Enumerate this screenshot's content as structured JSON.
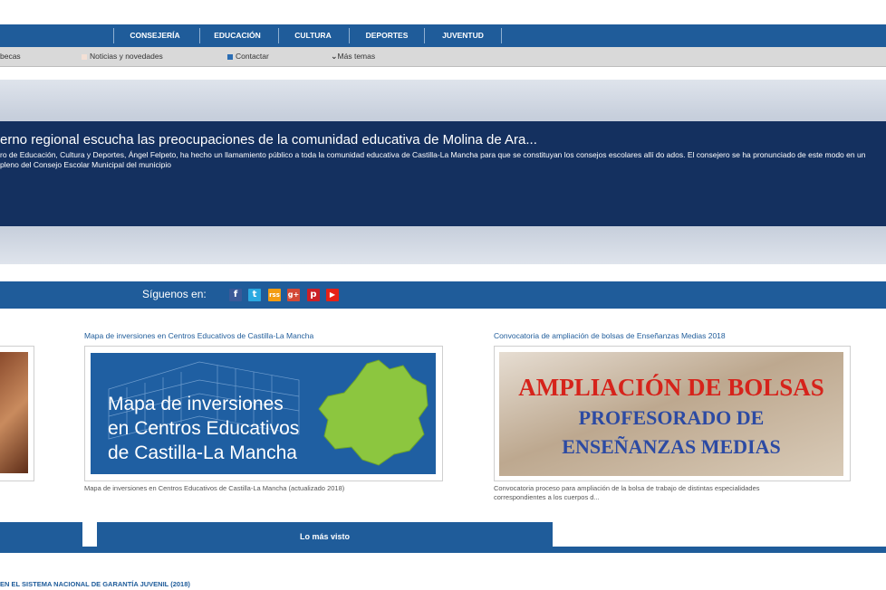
{
  "top_nav": {
    "items": [
      "CONSEJERÍA",
      "EDUCACIÓN",
      "CULTURA",
      "DEPORTES",
      "JUVENTUD"
    ]
  },
  "sub_nav": {
    "becas": "becas",
    "noticias": "Noticias y novedades",
    "contactar": "Contactar",
    "mas_temas": "Más temas"
  },
  "hero": {
    "title": "erno regional escucha las preocupaciones de la comunidad educativa de Molina de Ara...",
    "text": "ro de Educación, Cultura y Deportes, Ángel Felpeto, ha hecho un llamamiento público a toda la comunidad educativa de Castilla-La Mancha para que se constituyan los consejos escolares allí do ados. El consejero se ha pronunciado de este modo en un pleno del Consejo Escolar Municipal del municipio"
  },
  "follow": {
    "label": "Síguenos en:",
    "icons": [
      "f",
      "t",
      "rss",
      "g+",
      "p",
      "▶"
    ]
  },
  "cards": [
    {
      "title": "Mapa de inversiones en Centros Educativos de Castilla-La Mancha",
      "image_text": [
        "Mapa de inversiones",
        "en Centros Educativos",
        "de Castilla-La Mancha"
      ],
      "caption": "Mapa de inversiones en Centros Educativos de Castilla-La Mancha (actualizado 2018)"
    },
    {
      "title": "Convocatoria de ampliación de bolsas de Enseñanzas Medias 2018",
      "image_text": [
        "AMPLIACIÓN DE BOLSAS",
        "PROFESORADO DE",
        "ENSEÑANZAS MEDIAS"
      ],
      "caption_lines": [
        "Convocatoria proceso para ampliación de la bolsa de trabajo de distintas especialidades",
        "correspondientes a los cuerpos d..."
      ]
    }
  ],
  "tabs": {
    "mas_visto": "Lo más visto"
  },
  "bottom_link": "EN EL SISTEMA NACIONAL DE GARANTÍA JUVENIL (2018)",
  "colors": {
    "brand_blue": "#1f5c9a",
    "hero_band": "#14305f"
  }
}
